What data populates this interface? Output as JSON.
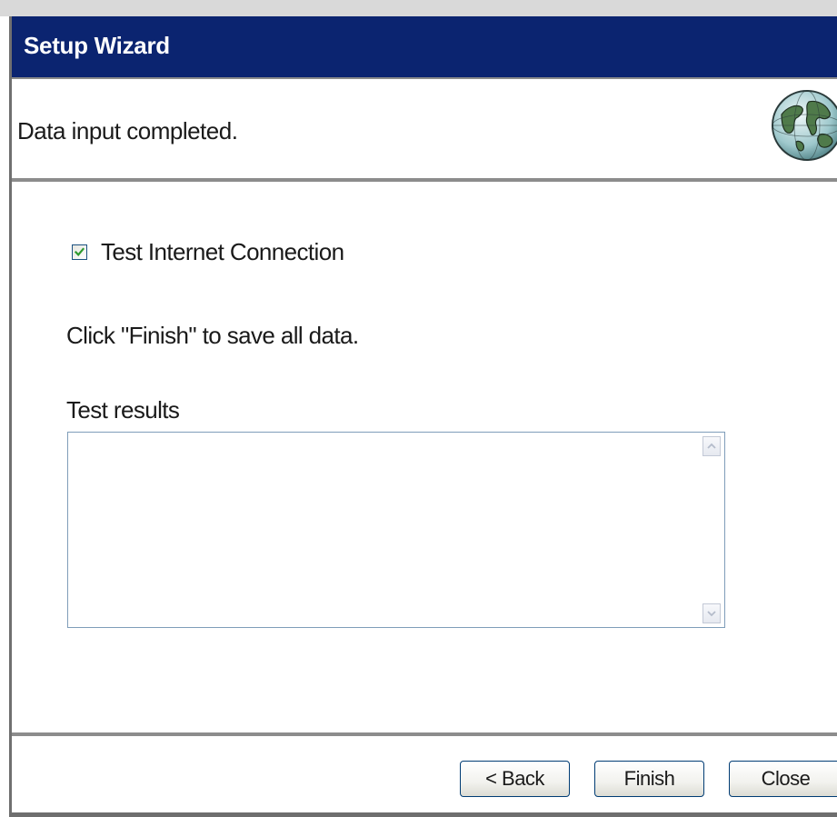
{
  "window": {
    "title": "Setup Wizard"
  },
  "header": {
    "subtitle": "Data input completed.",
    "logo_icon": "globe-icon"
  },
  "content": {
    "checkbox": {
      "label": "Test Internet Connection",
      "checked": true
    },
    "instruction": "Click \"Finish\" to save all data.",
    "results": {
      "label": "Test results",
      "value": ""
    }
  },
  "footer": {
    "back_label": "< Back",
    "finish_label": "Finish",
    "close_label": "Close"
  },
  "colors": {
    "titlebar": "#0b2470",
    "check_mark": "#2e9a2e",
    "button_border": "#003c74"
  }
}
